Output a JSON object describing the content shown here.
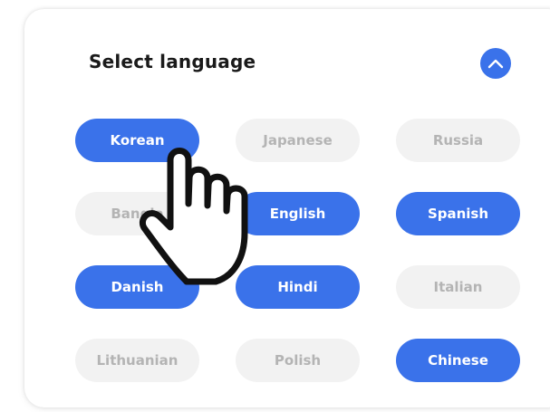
{
  "panel": {
    "title": "Select language",
    "collapse_icon": "chevron-up-icon"
  },
  "languages": [
    {
      "label": "Korean",
      "selected": true
    },
    {
      "label": "Japanese",
      "selected": false
    },
    {
      "label": "Russia",
      "selected": false
    },
    {
      "label": "Bangla",
      "selected": false
    },
    {
      "label": "English",
      "selected": true
    },
    {
      "label": "Spanish",
      "selected": true
    },
    {
      "label": "Danish",
      "selected": true
    },
    {
      "label": "Hindi",
      "selected": true
    },
    {
      "label": "Italian",
      "selected": false
    },
    {
      "label": "Lithuanian",
      "selected": false
    },
    {
      "label": "Polish",
      "selected": false
    },
    {
      "label": "Chinese",
      "selected": true
    }
  ],
  "pointer_icon": "hand-pointer-icon",
  "colors": {
    "accent": "#3a72ea",
    "chip_off_bg": "#f2f2f2",
    "chip_off_text": "#b4b4b4",
    "title_text": "#1a1a1a"
  }
}
